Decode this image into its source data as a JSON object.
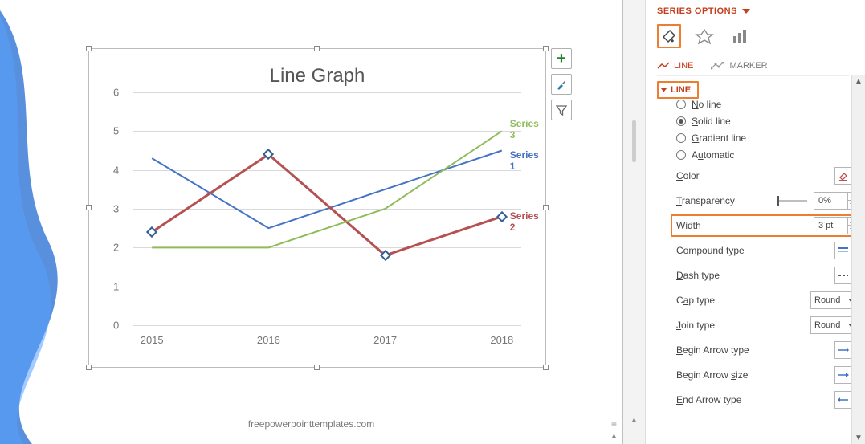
{
  "chart_data": {
    "type": "line",
    "title": "Line Graph",
    "categories": [
      "2015",
      "2016",
      "2017",
      "2018"
    ],
    "series": [
      {
        "name": "Series 1",
        "color": "#4472c4",
        "values": [
          4.3,
          2.5,
          3.5,
          4.5
        ]
      },
      {
        "name": "Series 2",
        "color": "#b55151",
        "values": [
          2.4,
          4.4,
          1.8,
          2.8
        ]
      },
      {
        "name": "Series 3",
        "color": "#8fbc5a",
        "values": [
          2.0,
          2.0,
          3.0,
          5.0
        ]
      }
    ],
    "xlabel": "",
    "ylabel": "",
    "ylim": [
      0,
      6
    ],
    "yticks": [
      0,
      1,
      2,
      3,
      4,
      5,
      6
    ]
  },
  "watermark": "freepowerpointtemplates.com",
  "buttons": {
    "add": "+",
    "brush": "brush",
    "filter": "filter"
  },
  "panel": {
    "header": "SERIES OPTIONS",
    "tabs": {
      "line": "LINE",
      "marker": "MARKER"
    },
    "section": "LINE",
    "radios": {
      "none": "No line",
      "solid": "Solid line",
      "gradient": "Gradient line",
      "auto": "Automatic",
      "selected": "solid"
    },
    "properties": {
      "color": "Color",
      "transparency": {
        "label": "Transparency",
        "value": "0%"
      },
      "width": {
        "label": "Width",
        "value": "3 pt"
      },
      "compound": "Compound type",
      "dash": "Dash type",
      "cap": {
        "label": "Cap type",
        "value": "Round"
      },
      "join": {
        "label": "Join type",
        "value": "Round"
      },
      "beginArrowType": "Begin Arrow type",
      "beginArrowSize": "Begin Arrow size",
      "endArrowType": "End Arrow type"
    }
  }
}
